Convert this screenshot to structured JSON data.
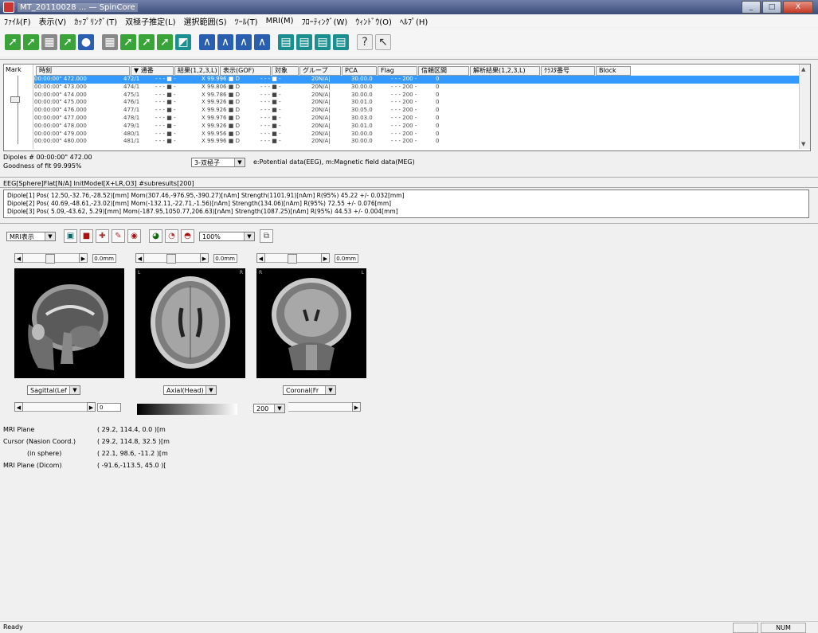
{
  "window": {
    "title": "MT_20110028 ... — SpinCore",
    "buttons": [
      "_",
      "□",
      "X"
    ]
  },
  "menu": [
    "ﾌｧｲﾙ(F)",
    "表示(V)",
    "ｶｯﾌﾟﾘﾝｸﾞ(T)",
    "双極子推定(L)",
    "選択範囲(S)",
    "ﾂｰﾙ(T)",
    "MRI(M)",
    "ﾌﾛｰﾃｨﾝｸﾞ(W)",
    "ｳｨﾝﾄﾞｳ(O)",
    "ﾍﾙﾌﾟ(H)"
  ],
  "toolbar": [
    "green-arrow-icon",
    "green-arrow-icon",
    "grid-icon",
    "green-arrow-icon",
    "blue-circle-icon",
    "grid-icon",
    "green-arrow-icon",
    "green-arrow-icon",
    "green-arrow-icon",
    "teal-icon",
    "wave-icon",
    "wave-icon",
    "wave-icon",
    "wave-icon",
    "table-icon",
    "table-icon",
    "table-icon",
    "table-icon",
    "help-icon",
    "pointer-icon"
  ],
  "list": {
    "side_label": "Mark",
    "columns": [
      "時刻",
      "▼ 通番",
      "結果(1,2,3,L)",
      "表示(GOF)",
      "対象",
      "グループ",
      "PCA",
      "Flag",
      "信頼区間",
      "解析結果(1,2,3,L)",
      "ｸﾗｽﾀ番号",
      "Block"
    ],
    "rows": [
      [
        "00:00:00\" 472.000",
        "472/1",
        "- - - ■ -",
        "X 99.996 ■ D",
        "- - - ■ -",
        "20N/A|",
        "30.00.0",
        "- - - 200 -",
        "0",
        true
      ],
      [
        "00:00:00\" 473.000",
        "474/1",
        "- - - ■ -",
        "X 99.806 ■ D",
        "- - - ■ -",
        "20N/A|",
        "30.00.0",
        "- - - 200 -",
        "0",
        false
      ],
      [
        "00:00:00\" 474.000",
        "475/1",
        "- - - ■ -",
        "X 99.786 ■ D",
        "- - - ■ -",
        "20N/A|",
        "30.00.0",
        "- - - 200 -",
        "0",
        false
      ],
      [
        "00:00:00\" 475.000",
        "476/1",
        "- - - ■ -",
        "X 99.926 ■ D",
        "- - - ■ -",
        "20N/A|",
        "30.01.0",
        "- - - 200 -",
        "0",
        false
      ],
      [
        "00:00:00\" 476.000",
        "477/1",
        "- - - ■ -",
        "X 99.926 ■ D",
        "- - - ■ -",
        "20N/A|",
        "30.05.0",
        "- - - 200 -",
        "0",
        false
      ],
      [
        "00:00:00\" 477.000",
        "478/1",
        "- - - ■ -",
        "X 99.976 ■ D",
        "- - - ■ -",
        "20N/A|",
        "30.03.0",
        "- - - 200 -",
        "0",
        false
      ],
      [
        "00:00:00\" 478.000",
        "479/1",
        "- - - ■ -",
        "X 99.926 ■ D",
        "- - - ■ -",
        "20N/A|",
        "30.01.0",
        "- - - 200 -",
        "0",
        false
      ],
      [
        "00:00:00\" 479.000",
        "480/1",
        "- - - ■ -",
        "X 99.956 ■ D",
        "- - - ■ -",
        "20N/A|",
        "30.00.0",
        "- - - 200 -",
        "0",
        false
      ],
      [
        "00:00:00\" 480.000",
        "481/1",
        "- - - ■ -",
        "X 99.996 ■ D",
        "- - - ■ -",
        "20N/A|",
        "30.00.0",
        "- - - 200 -",
        "0",
        false
      ]
    ]
  },
  "info": {
    "dipoles": "Dipoles #   00:00:00\" 472.00",
    "gof": "Goodness of fit   99.995%",
    "model_combo": "3-双極子",
    "model_text": "e:Potential data(EEG), m:Magnetic field data(MEG)"
  },
  "param_line": "EEG[Sphere]Flat[N/A] InitModel[X+LR,O3] #subresults[200]",
  "dipole_lines": [
    "Dipole[1]  Pos( 12.50,-32.76,-28.52)[mm]  Mom(307.46,-976.95,-390.27)[nAm]  Strength(1101.91)[nAm]  R(95%) 45.22 +/- 0.032[mm]",
    "Dipole[2]  Pos( 40.69,-48.61,-23.02)[mm]  Mom(-132.11,-22.71,-1.56)[nAm]  Strength(134.06)[nAm]  R(95%) 72.55 +/- 0.076[mm]",
    "Dipole[3]  Pos( 5.09,-43.62, 5.29)[mm]  Mom(-187.95,1050.77,206.63)[nAm]  Strength(1087.25)[nAm]  R(95%) 44.53 +/- 0.004[mm]"
  ],
  "viewer": {
    "mode_combo": "MRI表示",
    "zoom": "100%",
    "sliders": [
      "0.0mm",
      "0.0mm",
      "0.0mm"
    ],
    "view_labels": [
      [
        "",
        ""
      ],
      [
        "L",
        "R"
      ],
      [
        "R",
        "L"
      ]
    ],
    "planes": [
      "Sagittal(Lef",
      "Axial(Head)",
      "Coronal(Fr"
    ],
    "left_value": "0",
    "right_value": "200"
  },
  "coords": [
    [
      "MRI Plane",
      "( 29.2, 114.4,  0.0 )[m"
    ],
    [
      "Cursor (Nasion Coord.)",
      "( 29.2, 114.8,  32.5 )[m"
    ],
    [
      "(in sphere)",
      "( 22.1,  98.6, -11.2 )[m"
    ],
    [
      "MRI Plane (Dicom)",
      "( -91.6,-113.5,  45.0 )["
    ]
  ],
  "status": {
    "text": "Ready",
    "num": "NUM"
  }
}
